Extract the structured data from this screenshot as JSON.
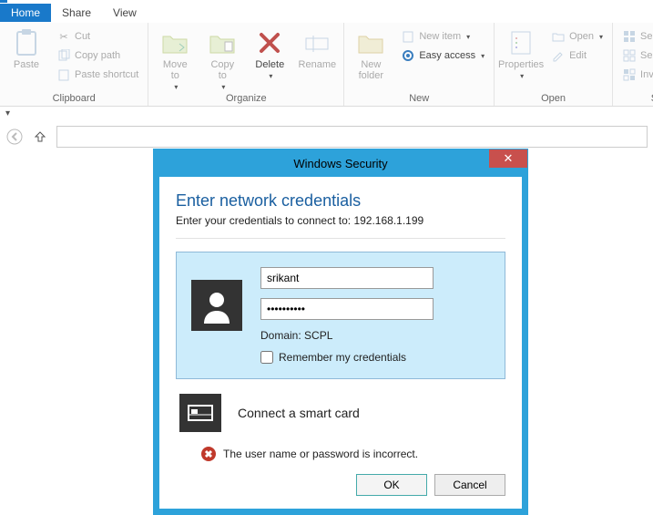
{
  "tabs": {
    "home": "Home",
    "share": "Share",
    "view": "View"
  },
  "ribbon": {
    "clipboard": {
      "label": "Clipboard",
      "paste": "Paste",
      "cut": "Cut",
      "copy_path": "Copy path",
      "paste_shortcut": "Paste shortcut"
    },
    "organize": {
      "label": "Organize",
      "move_to": "Move\nto",
      "copy_to": "Copy\nto",
      "delete": "Delete",
      "rename": "Rename"
    },
    "new": {
      "label": "New",
      "new_folder": "New\nfolder",
      "new_item": "New item",
      "easy_access": "Easy access"
    },
    "open": {
      "label": "Open",
      "properties": "Properties",
      "open": "Open",
      "edit": "Edit"
    },
    "select": {
      "label": "Select",
      "select_all": "Select all",
      "select_none": "Select none",
      "invert": "Invert selection"
    }
  },
  "dialog": {
    "title": "Windows Security",
    "heading": "Enter network credentials",
    "sub": "Enter your credentials to connect to: 192.168.1.199",
    "username": "srikant",
    "password": "••••••••••",
    "domain": "Domain: SCPL",
    "remember": "Remember my credentials",
    "smartcard": "Connect a smart card",
    "error": "The user name or password is incorrect.",
    "ok": "OK",
    "cancel": "Cancel"
  }
}
